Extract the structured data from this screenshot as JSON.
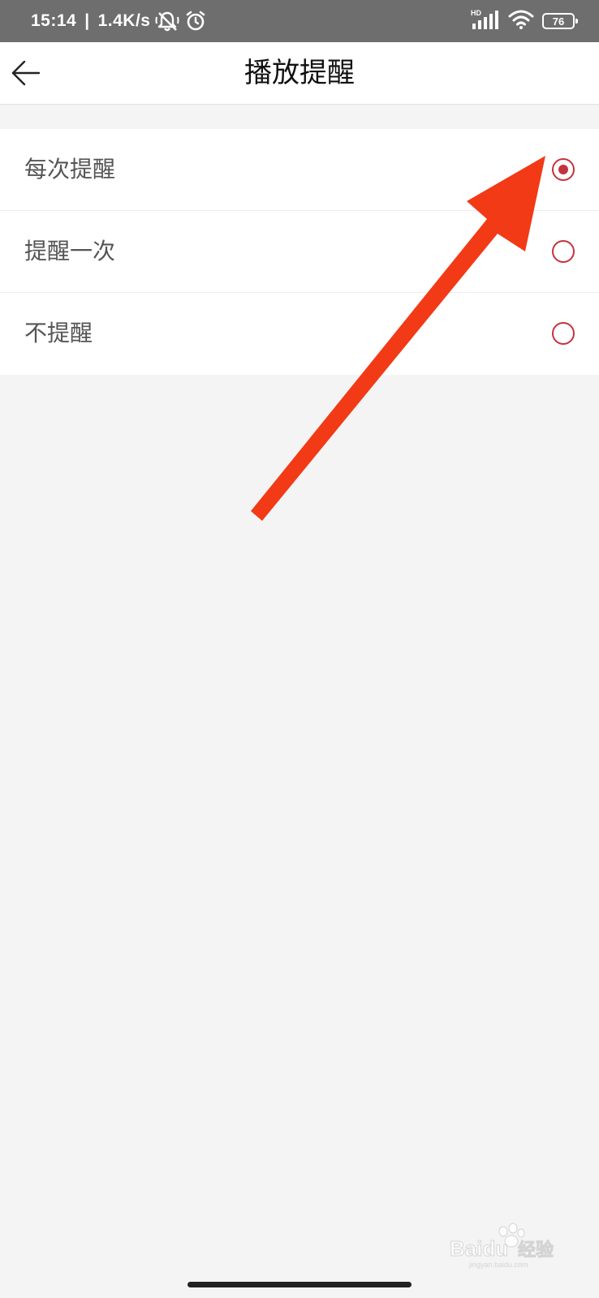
{
  "status_bar": {
    "time": "15:14",
    "separator": "|",
    "network_speed": "1.4K/s",
    "icons_left": [
      "muted-bell-icon",
      "alarm-clock-icon"
    ],
    "icons_right": [
      "hd-signal-icon",
      "wifi-icon",
      "battery-icon"
    ],
    "signal_badge": "HD",
    "battery_level": "76"
  },
  "header": {
    "back_icon": "arrow-left-icon",
    "title": "播放提醒"
  },
  "options": [
    {
      "label": "每次提醒",
      "selected": true
    },
    {
      "label": "提醒一次",
      "selected": false
    },
    {
      "label": "不提醒",
      "selected": false
    }
  ],
  "annotation": {
    "icon": "red-arrow-annotation",
    "color": "#f23a16"
  },
  "watermark": {
    "brand_latin": "Baidu",
    "brand_cn": "经验",
    "url": "jingyan.baidu.com"
  },
  "colors": {
    "accent": "#c5333d",
    "status_bar_bg": "#6e6e6e",
    "page_bg": "#f4f4f4"
  }
}
